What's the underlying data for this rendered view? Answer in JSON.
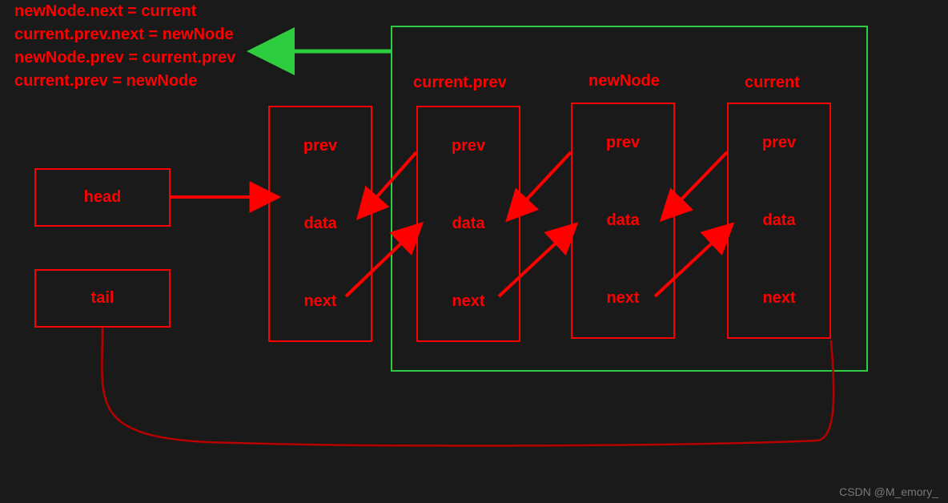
{
  "code": {
    "line1": "newNode.next = current",
    "line2": "current.prev.next = newNode",
    "line3": "newNode.prev = current.prev",
    "line4": "current.prev = newNode"
  },
  "pointers": {
    "head": "head",
    "tail": "tail"
  },
  "nodeFields": {
    "prev": "prev",
    "data": "data",
    "next": "next"
  },
  "labels": {
    "currentPrev": "current.prev",
    "newNode": "newNode",
    "current": "current"
  },
  "watermark": "CSDN @M_emory_"
}
